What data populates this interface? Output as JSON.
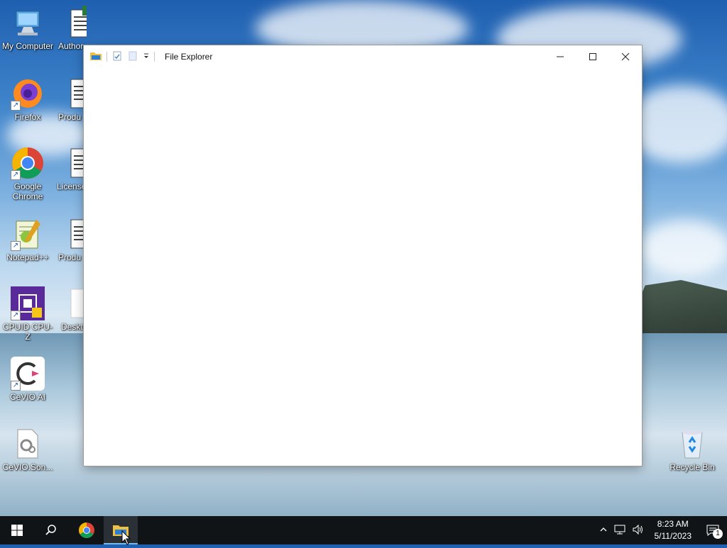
{
  "desktop": {
    "icons_left": [
      {
        "label": "My Computer"
      },
      {
        "label": "Firefox"
      },
      {
        "label": "Google Chrome"
      },
      {
        "label": "Notepad++"
      },
      {
        "label": "CPUID CPU-Z"
      },
      {
        "label": "CeVIO AI"
      },
      {
        "label": "CeVIO.Son..."
      }
    ],
    "icons_second": [
      {
        "label": "Author"
      },
      {
        "label": "Produ"
      },
      {
        "label": "License"
      },
      {
        "label": "Produ"
      },
      {
        "label": "Deskt"
      }
    ],
    "recycle_bin": {
      "label": "Recycle Bin"
    }
  },
  "window": {
    "title": "File Explorer",
    "controls": {
      "minimize": "–",
      "maximize": "☐",
      "close": "✕"
    }
  },
  "taskbar": {
    "clock_time": "8:23 AM",
    "clock_date": "5/11/2023",
    "notification_count": "1"
  }
}
